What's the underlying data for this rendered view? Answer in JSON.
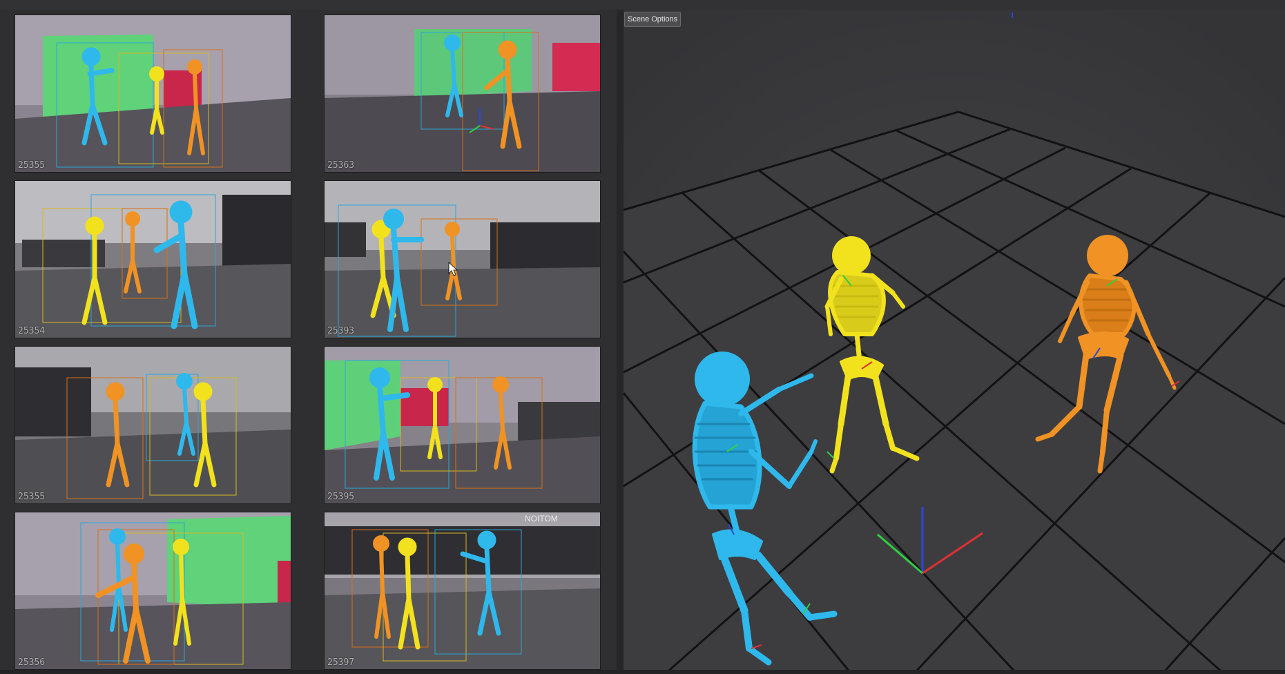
{
  "viewport": {
    "scene_options_label": "Scene Options"
  },
  "cameras": [
    {
      "id": "25355",
      "theme": "green"
    },
    {
      "id": "25363",
      "theme": "green"
    },
    {
      "id": "25354",
      "theme": "office"
    },
    {
      "id": "25393",
      "theme": "office"
    },
    {
      "id": "25355",
      "theme": "office"
    },
    {
      "id": "25395",
      "theme": "green"
    },
    {
      "id": "25356",
      "theme": "green"
    },
    {
      "id": "25397",
      "theme": "office"
    }
  ],
  "overlay_text": {
    "studio_sign": "NOITOM"
  },
  "colors": {
    "skeleton_blue": "#2fb8ec",
    "skeleton_yellow": "#f2e21d",
    "skeleton_orange": "#f09224",
    "grid_floor": "#3f3f41",
    "grid_line": "#111111"
  }
}
